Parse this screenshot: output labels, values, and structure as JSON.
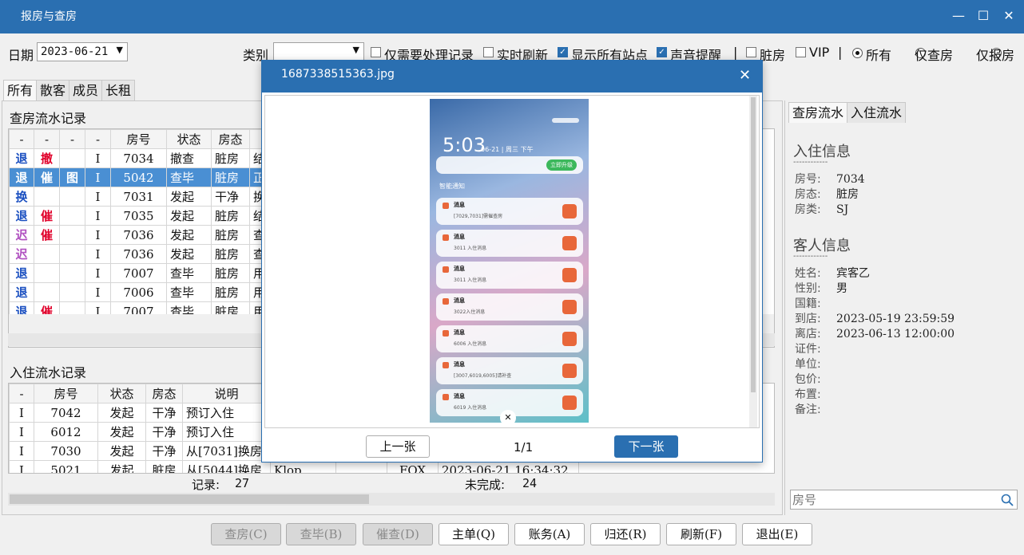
{
  "window": {
    "title": "报房与查房"
  },
  "toolbar": {
    "date_label": "日期",
    "date_value": "2023-06-21",
    "category_label": "类别",
    "category_value": "",
    "only_pending": "仅需要处理记录",
    "realtime": "实时刷新",
    "show_all": "显示所有站点",
    "sound": "声音提醒",
    "separator": "|",
    "dirty": "脏房",
    "vip": "VIP",
    "radio_all": "所有",
    "radio_check": "仅查房",
    "radio_report": "仅报房"
  },
  "tabs": [
    "所有",
    "散客",
    "成员",
    "长租"
  ],
  "check_section": {
    "title": "查房流水记录",
    "headers": [
      "-",
      "-",
      "-",
      "-",
      "房号",
      "状态",
      "房态"
    ],
    "rows": [
      {
        "a": "退",
        "b": "撤",
        "c": "",
        "d": "I",
        "room": "7034",
        "status": "撤查",
        "state": "脏房",
        "note": "结"
      },
      {
        "a": "退",
        "b": "催",
        "c": "图",
        "d": "I",
        "room": "5042",
        "status": "查毕",
        "state": "脏房",
        "note": "正"
      },
      {
        "a": "换",
        "b": "",
        "c": "",
        "d": "I",
        "room": "7031",
        "status": "发起",
        "state": "干净",
        "note": "换"
      },
      {
        "a": "退",
        "b": "催",
        "c": "",
        "d": "I",
        "room": "7035",
        "status": "发起",
        "state": "脏房",
        "note": "结"
      },
      {
        "a": "迟",
        "b": "催",
        "c": "",
        "d": "I",
        "room": "7036",
        "status": "发起",
        "state": "脏房",
        "note": "查"
      },
      {
        "a": "迟",
        "b": "",
        "c": "",
        "d": "I",
        "room": "7036",
        "status": "发起",
        "state": "脏房",
        "note": "查"
      },
      {
        "a": "退",
        "b": "",
        "c": "",
        "d": "I",
        "room": "7007",
        "status": "查毕",
        "state": "脏房",
        "note": "用"
      },
      {
        "a": "退",
        "b": "",
        "c": "",
        "d": "I",
        "room": "7006",
        "status": "查毕",
        "state": "脏房",
        "note": "用"
      },
      {
        "a": "退",
        "b": "催",
        "c": "",
        "d": "I",
        "room": "7007",
        "status": "查毕",
        "state": "脏房",
        "note": "用"
      }
    ]
  },
  "checkin_section": {
    "title": "入住流水记录",
    "headers": [
      "-",
      "房号",
      "状态",
      "房态",
      "说明"
    ],
    "rows": [
      {
        "d": "I",
        "room": "7042",
        "status": "发起",
        "state": "干净",
        "note": "预订入住"
      },
      {
        "d": "I",
        "room": "6012",
        "status": "发起",
        "state": "干净",
        "note": "预订入住"
      },
      {
        "d": "I",
        "room": "7030",
        "status": "发起",
        "state": "干净",
        "note": "从[7031]换房"
      },
      {
        "d": "I",
        "room": "5021",
        "status": "发起",
        "state": "脏房",
        "note": "从[5044]换房",
        "user": "Klop",
        "op": "FOX",
        "time": "2023-06-21 16:34:32"
      }
    ],
    "records_label": "记录:",
    "records": "27",
    "pending_label": "未完成:",
    "pending": "24"
  },
  "right_panel": {
    "tabs": [
      "查房流水",
      "入住流水"
    ],
    "checkin_title": "入住信息",
    "divider": "------------",
    "checkin": [
      {
        "k": "房号:",
        "v": "7034"
      },
      {
        "k": "房态:",
        "v": "脏房"
      },
      {
        "k": "房类:",
        "v": "SJ"
      }
    ],
    "guest_title": "客人信息",
    "guest": [
      {
        "k": "姓名:",
        "v": "宾客乙"
      },
      {
        "k": "性别:",
        "v": "男"
      },
      {
        "k": "国籍:",
        "v": ""
      },
      {
        "k": "到店:",
        "v": "2023-05-19 23:59:59"
      },
      {
        "k": "离店:",
        "v": "2023-06-13 12:00:00"
      },
      {
        "k": "证件:",
        "v": ""
      },
      {
        "k": "单位:",
        "v": ""
      },
      {
        "k": "包价:",
        "v": ""
      },
      {
        "k": "布置:",
        "v": ""
      },
      {
        "k": "备注:",
        "v": ""
      }
    ],
    "search_placeholder": "房号"
  },
  "bottom_buttons": [
    {
      "label": "查房(C)",
      "disabled": true
    },
    {
      "label": "查毕(B)",
      "disabled": true
    },
    {
      "label": "催查(D)",
      "disabled": true
    },
    {
      "label": "主单(Q)",
      "disabled": false
    },
    {
      "label": "账务(A)",
      "disabled": false
    },
    {
      "label": "归还(R)",
      "disabled": false
    },
    {
      "label": "刷新(F)",
      "disabled": false
    },
    {
      "label": "退出(E)",
      "disabled": false
    }
  ],
  "dialog": {
    "title": "1687338515363.jpg",
    "prev": "上一张",
    "next": "下一张",
    "page": "1/1",
    "phone": {
      "time": "5:03",
      "date": "06-21 | 周三 下午",
      "section": "智能通知",
      "upgrade": "立即升级",
      "notifications": [
        {
          "title": "消息",
          "body": "[7029,7031]需催查房"
        },
        {
          "title": "消息",
          "body": "3011 入住消息"
        },
        {
          "title": "消息",
          "body": "3011 入住消息"
        },
        {
          "title": "消息",
          "body": "3022入住消息"
        },
        {
          "title": "消息",
          "body": "6006 入住消息"
        },
        {
          "title": "消息",
          "body": "[3007,6019,6005]请补查"
        },
        {
          "title": "消息",
          "body": "6019 入住消息"
        }
      ]
    }
  }
}
